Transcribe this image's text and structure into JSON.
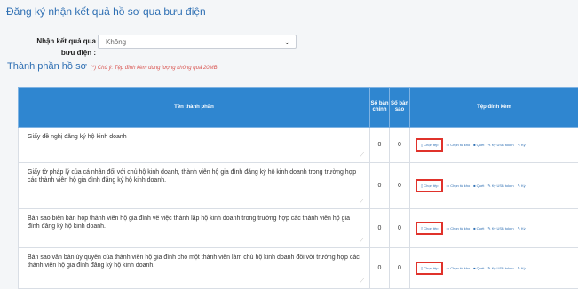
{
  "header": {
    "title": "Đăng ký nhận kết quả hồ sơ qua bưu điện"
  },
  "receive": {
    "label_line1": "Nhận kết quả qua",
    "label_line2": "bưu điện :",
    "value": "Không"
  },
  "components": {
    "title": "Thành phần hồ sơ",
    "note": "(*) Chú ý: Tệp đính kèm dung lượng không quá 20MB"
  },
  "table": {
    "headers": {
      "name": "Tên thành phần",
      "original": "Số bản chính",
      "copy": "Số bản sao",
      "files": "Tệp đính kèm"
    },
    "rows": [
      {
        "name": "Giấy đề nghị đăng ký hộ kinh doanh",
        "original": "0",
        "copy": "0"
      },
      {
        "name": "Giấy tờ pháp lý của cá nhân đối với chủ hộ kinh doanh, thành viên hộ gia đình đăng ký hộ kinh doanh trong trường hợp các thành viên hộ gia đình đăng ký hộ kinh doanh.",
        "original": "0",
        "copy": "0"
      },
      {
        "name": "Bản sao biên bản họp thành viên hộ gia đình về việc thành lập hộ kinh doanh trong trường hợp các thành viên hộ gia đình đăng ký hộ kinh doanh.",
        "original": "0",
        "copy": "0"
      },
      {
        "name": "Bản sao văn bản ủy quyền của thành viên hộ gia đình cho một thành viên làm chủ hộ kinh doanh đối với trường hợp các thành viên hộ gia đình đăng ký hộ kinh doanh.",
        "original": "0",
        "copy": "0"
      }
    ],
    "file_actions": {
      "choose": "Chọn tệp",
      "choose_from_repo": "Chọn từ kho",
      "scan": "Quét",
      "sign_usb": "Ký USB token",
      "sign": "Ký"
    }
  }
}
